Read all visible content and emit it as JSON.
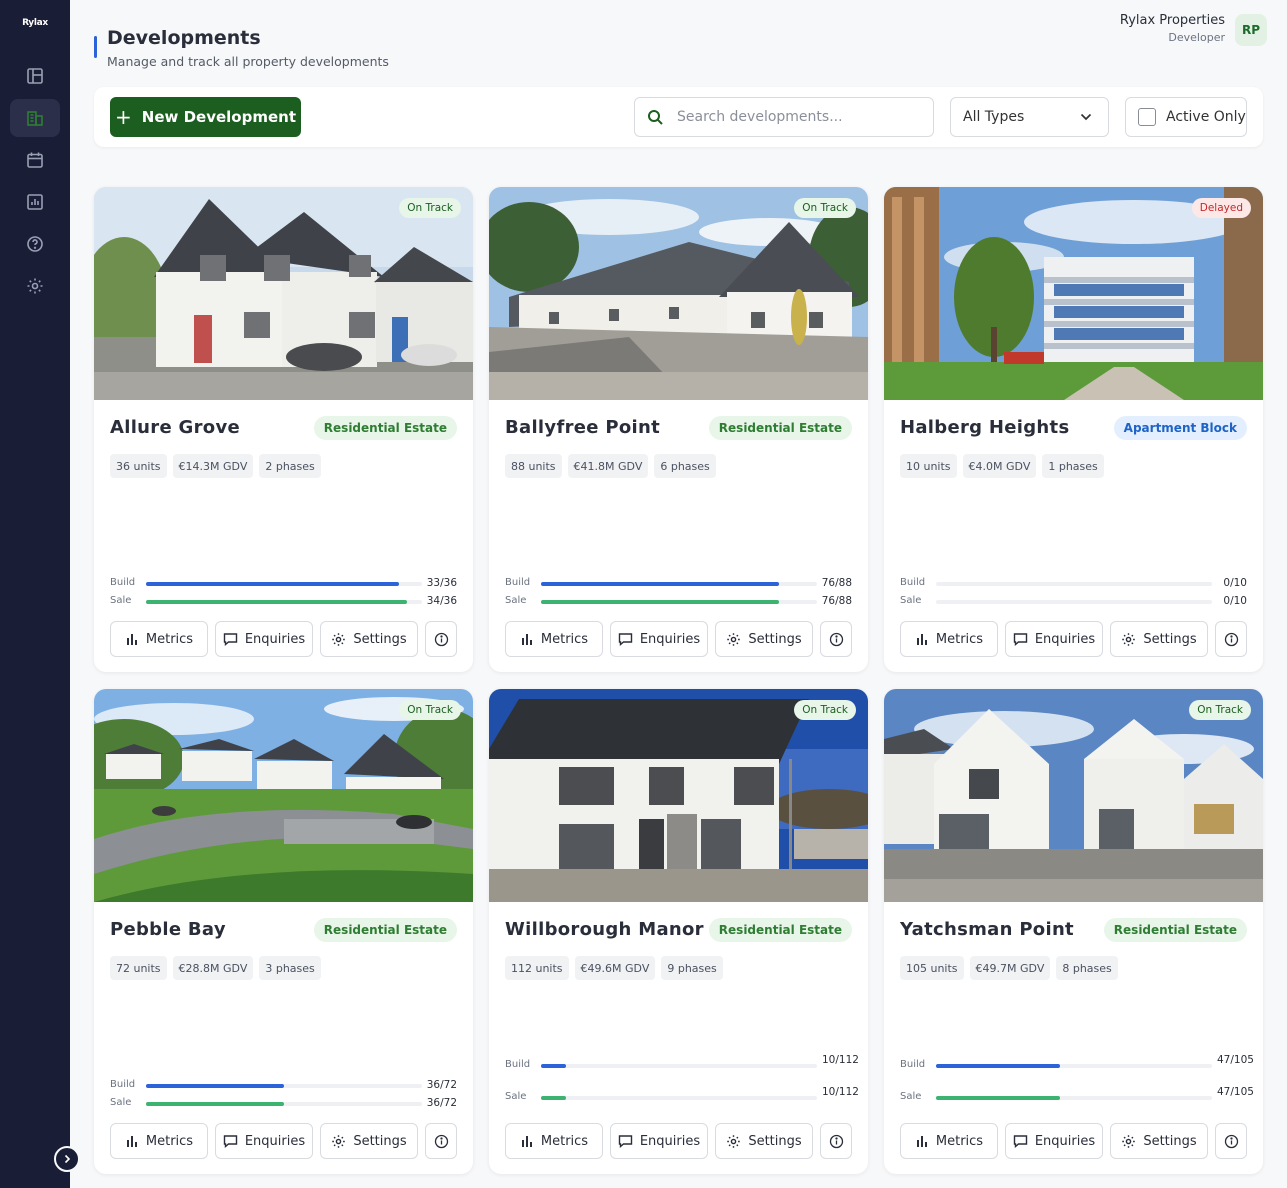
{
  "app": {
    "logo": "Rylax"
  },
  "sidebar": {
    "items": [
      {
        "name": "dashboard",
        "icon": "layout-icon"
      },
      {
        "name": "developments",
        "icon": "buildings-icon",
        "active": true
      },
      {
        "name": "calendar",
        "icon": "calendar-icon"
      },
      {
        "name": "reports",
        "icon": "chart-icon"
      },
      {
        "name": "help",
        "icon": "help-icon"
      },
      {
        "name": "settings",
        "icon": "gear-icon"
      }
    ]
  },
  "header": {
    "title": "Developments",
    "subtitle": "Manage and track all property developments"
  },
  "user": {
    "name": "Rylax Properties",
    "role": "Developer",
    "initials": "RP"
  },
  "toolbar": {
    "new_label": "New Development",
    "search_placeholder": "Search developments...",
    "type_select": "All Types",
    "active_only_label": "Active Only"
  },
  "labels": {
    "build": "Build",
    "sale": "Sale",
    "metrics": "Metrics",
    "enquiries": "Enquiries",
    "settings": "Settings"
  },
  "colors": {
    "primary": "#1b5e20",
    "build": "#2d63d8",
    "sale": "#3cb371",
    "sidebar": "#1a1d36"
  },
  "developments": [
    {
      "name": "Allure Grove",
      "status": "On Track",
      "type": "Residential Estate",
      "units": "36 units",
      "gdv": "€14.3M GDV",
      "phases": "2 phases",
      "build": "33/36",
      "sale": "34/36",
      "build_pct": 0.917,
      "sale_pct": 0.944
    },
    {
      "name": "Ballyfree Point",
      "status": "On Track",
      "type": "Residential Estate",
      "units": "88 units",
      "gdv": "€41.8M GDV",
      "phases": "6 phases",
      "build": "76/88",
      "sale": "76/88",
      "build_pct": 0.864,
      "sale_pct": 0.864
    },
    {
      "name": "Halberg Heights",
      "status": "Delayed",
      "type": "Apartment Block",
      "units": "10 units",
      "gdv": "€4.0M GDV",
      "phases": "1 phases",
      "build": "0/10",
      "sale": "0/10",
      "build_pct": 0,
      "sale_pct": 0
    },
    {
      "name": "Pebble Bay",
      "status": "On Track",
      "type": "Residential Estate",
      "units": "72 units",
      "gdv": "€28.8M GDV",
      "phases": "3 phases",
      "build": "36/72",
      "sale": "36/72",
      "build_pct": 0.5,
      "sale_pct": 0.5
    },
    {
      "name": "Willborough Manor",
      "status": "On Track",
      "type": "Residential Estate",
      "units": "112 units",
      "gdv": "€49.6M GDV",
      "phases": "9 phases",
      "build": "10/112",
      "sale": "10/112",
      "build_pct": 0.089,
      "sale_pct": 0.089
    },
    {
      "name": "Yatchsman Point",
      "status": "On Track",
      "type": "Residential Estate",
      "units": "105 units",
      "gdv": "€49.7M GDV",
      "phases": "8 phases",
      "build": "47/105",
      "sale": "47/105",
      "build_pct": 0.448,
      "sale_pct": 0.448
    }
  ]
}
